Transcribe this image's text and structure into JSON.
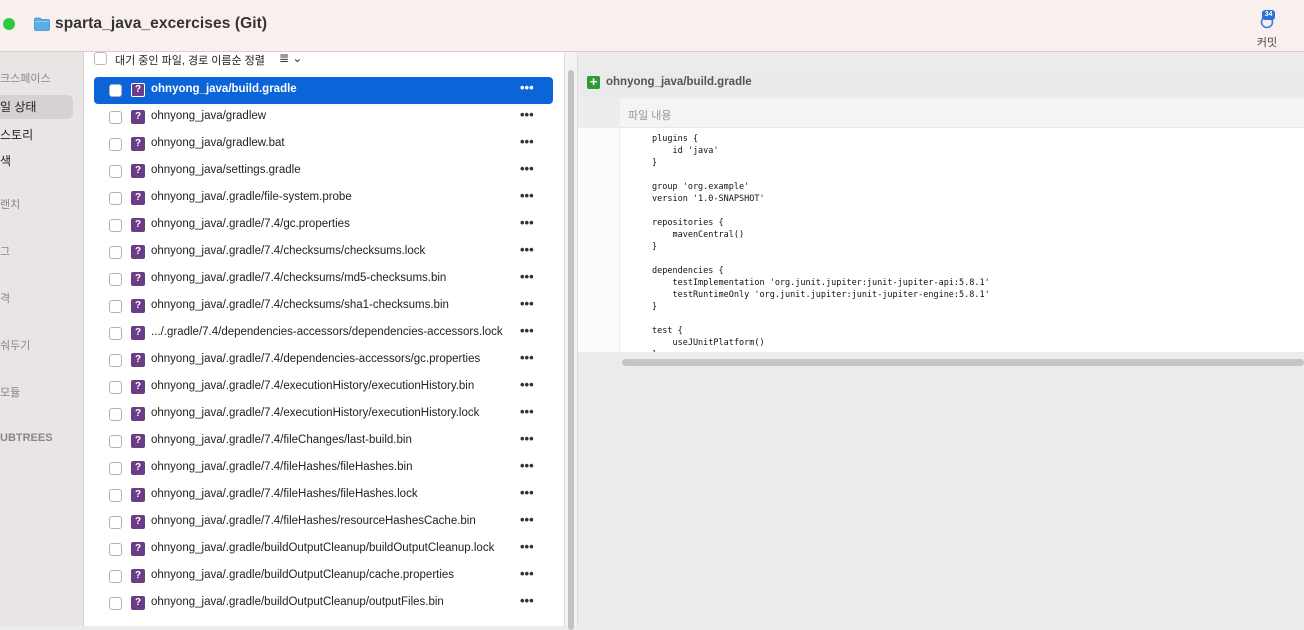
{
  "window": {
    "title": "sparta_java_excercises (Git)",
    "commit_label": "커밋",
    "commit_badge": "34"
  },
  "sidebar": {
    "items": [
      {
        "label": "크스페이스",
        "kind": "section"
      },
      {
        "label": "일 상태",
        "kind": "nav",
        "selected": true
      },
      {
        "label": "스토리",
        "kind": "nav"
      },
      {
        "label": "색",
        "kind": "nav"
      },
      {
        "label": "랜치",
        "kind": "section"
      },
      {
        "label": "그",
        "kind": "section"
      },
      {
        "label": "격",
        "kind": "section"
      },
      {
        "label": "숴두기",
        "kind": "section"
      },
      {
        "label": "모듈",
        "kind": "section"
      },
      {
        "label": "UBTREES",
        "kind": "section"
      }
    ]
  },
  "filelist": {
    "header_label": "대기 중인 파일, 경로 이름순 정렬",
    "header_menu": "≣ ⌄",
    "status_icon": "?",
    "more": "•••",
    "files": [
      {
        "name": "ohnyong_java/build.gradle",
        "selected": true
      },
      {
        "name": "ohnyong_java/gradlew"
      },
      {
        "name": "ohnyong_java/gradlew.bat"
      },
      {
        "name": "ohnyong_java/settings.gradle"
      },
      {
        "name": "ohnyong_java/.gradle/file-system.probe"
      },
      {
        "name": "ohnyong_java/.gradle/7.4/gc.properties"
      },
      {
        "name": "ohnyong_java/.gradle/7.4/checksums/checksums.lock"
      },
      {
        "name": "ohnyong_java/.gradle/7.4/checksums/md5-checksums.bin"
      },
      {
        "name": "ohnyong_java/.gradle/7.4/checksums/sha1-checksums.bin"
      },
      {
        "name": ".../.gradle/7.4/dependencies-accessors/dependencies-accessors.lock"
      },
      {
        "name": "ohnyong_java/.gradle/7.4/dependencies-accessors/gc.properties"
      },
      {
        "name": "ohnyong_java/.gradle/7.4/executionHistory/executionHistory.bin"
      },
      {
        "name": "ohnyong_java/.gradle/7.4/executionHistory/executionHistory.lock"
      },
      {
        "name": "ohnyong_java/.gradle/7.4/fileChanges/last-build.bin"
      },
      {
        "name": "ohnyong_java/.gradle/7.4/fileHashes/fileHashes.bin"
      },
      {
        "name": "ohnyong_java/.gradle/7.4/fileHashes/fileHashes.lock"
      },
      {
        "name": "ohnyong_java/.gradle/7.4/fileHashes/resourceHashesCache.bin"
      },
      {
        "name": "ohnyong_java/.gradle/buildOutputCleanup/buildOutputCleanup.lock"
      },
      {
        "name": "ohnyong_java/.gradle/buildOutputCleanup/cache.properties"
      },
      {
        "name": "ohnyong_java/.gradle/buildOutputCleanup/outputFiles.bin"
      }
    ]
  },
  "diff": {
    "file": "ohnyong_java/build.gradle",
    "hunk_label": "파일 내용",
    "lines": [
      "plugins {",
      "    id 'java'",
      "}",
      "",
      "group 'org.example'",
      "version '1.0-SNAPSHOT'",
      "",
      "repositories {",
      "    mavenCentral()",
      "}",
      "",
      "dependencies {",
      "    testImplementation 'org.junit.jupiter:junit-jupiter-api:5.8.1'",
      "    testRuntimeOnly 'org.junit.jupiter:junit-jupiter-engine:5.8.1'",
      "}",
      "",
      "test {",
      "    useJUnitPlatform()",
      "}"
    ]
  },
  "colors": {
    "selection": "#0b64d8",
    "untracked_icon": "#6a3d86",
    "added_icon": "#2f9a36",
    "commit_badge": "#2e6fd8"
  }
}
